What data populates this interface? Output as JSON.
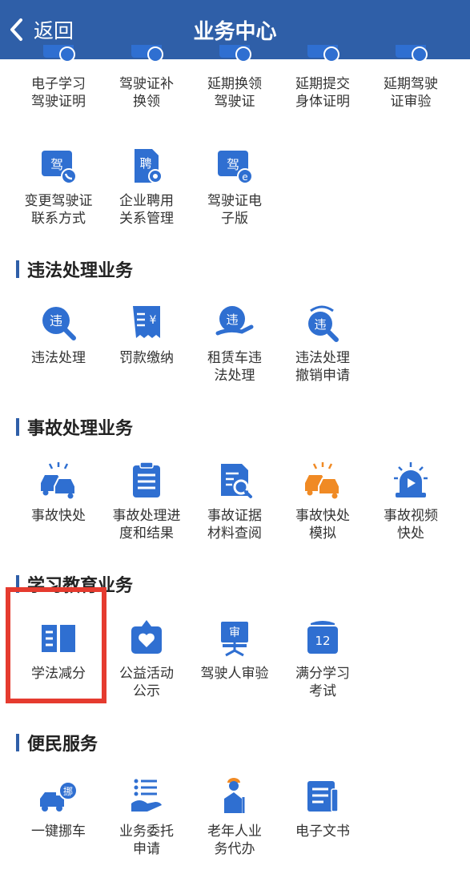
{
  "header": {
    "back_label": "返回",
    "title": "业务中心"
  },
  "license_items_row1": [
    {
      "label": "电子学习\n驾驶证明",
      "icon": "license-icon"
    },
    {
      "label": "驾驶证补\n换领",
      "icon": "license-renew-icon"
    },
    {
      "label": "延期换领\n驾驶证",
      "icon": "license-delay-icon"
    },
    {
      "label": "延期提交\n身体证明",
      "icon": "health-cert-icon"
    },
    {
      "label": "延期驾驶\n证审验",
      "icon": "license-review-icon"
    }
  ],
  "license_items_row2": [
    {
      "label": "变更驾驶证\n联系方式",
      "icon": "license-phone-icon",
      "glyph": "驾"
    },
    {
      "label": "企业聘用\n关系管理",
      "icon": "employment-icon",
      "glyph": "聘"
    },
    {
      "label": "驾驶证电\n子版",
      "icon": "e-license-icon",
      "glyph": "驾"
    }
  ],
  "sections": {
    "violation": {
      "title": "违法处理业务",
      "items": [
        {
          "label": "违法处理",
          "icon": "violation-icon",
          "glyph": "违"
        },
        {
          "label": "罚款缴纳",
          "icon": "fine-payment-icon",
          "glyph": "¥"
        },
        {
          "label": "租赁车违\n法处理",
          "icon": "rental-violation-icon",
          "glyph": "违"
        },
        {
          "label": "违法处理\n撤销申请",
          "icon": "violation-revoke-icon",
          "glyph": "违"
        }
      ]
    },
    "accident": {
      "title": "事故处理业务",
      "items": [
        {
          "label": "事故快处",
          "icon": "accident-cars-icon"
        },
        {
          "label": "事故处理进\n度和结果",
          "icon": "accident-progress-icon"
        },
        {
          "label": "事故证据\n材料查阅",
          "icon": "evidence-search-icon"
        },
        {
          "label": "事故快处\n模拟",
          "icon": "accident-sim-icon"
        },
        {
          "label": "事故视频\n快处",
          "icon": "video-alarm-icon"
        }
      ]
    },
    "education": {
      "title": "学习教育业务",
      "items": [
        {
          "label": "学法减分",
          "icon": "book-icon"
        },
        {
          "label": "公益活动\n公示",
          "icon": "charity-icon"
        },
        {
          "label": "驾驶人审验",
          "icon": "driver-review-icon",
          "glyph": "审"
        },
        {
          "label": "满分学习\n考试",
          "icon": "full-score-exam-icon",
          "glyph": "12"
        }
      ]
    },
    "convenience": {
      "title": "便民服务",
      "items": [
        {
          "label": "一键挪车",
          "icon": "move-car-icon",
          "glyph": "挪"
        },
        {
          "label": "业务委托\n申请",
          "icon": "delegation-icon"
        },
        {
          "label": "老年人业\n务代办",
          "icon": "elderly-icon"
        },
        {
          "label": "电子文书",
          "icon": "e-document-icon"
        }
      ]
    }
  },
  "colors": {
    "header": "#2f5fa8",
    "icon_blue": "#2f6fd1",
    "icon_orange": "#f08a24",
    "highlight": "#e53b2f"
  }
}
